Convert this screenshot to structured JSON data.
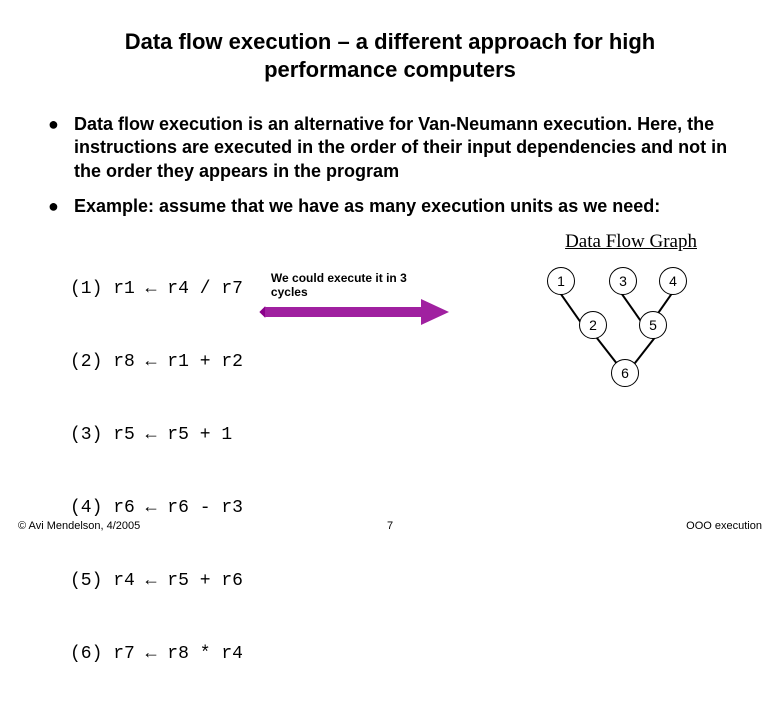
{
  "title": "Data flow execution – a different approach for high performance computers",
  "bullets": [
    "Data flow execution is an alternative for Van-Neumann execution. Here, the instructions are executed in the order of their input dependencies and not in the order they appears in the program",
    "Example: assume that we have as many execution units as we need:"
  ],
  "code": [
    {
      "n": "(1)",
      "d": "r1",
      "a": "←",
      "s1": "r4",
      "op": "/",
      "s2": "r7"
    },
    {
      "n": "(2)",
      "d": "r8",
      "a": "←",
      "s1": "r1",
      "op": "+",
      "s2": "r2"
    },
    {
      "n": "(3)",
      "d": "r5",
      "a": "←",
      "s1": "r5",
      "op": "+",
      "s2": "1"
    },
    {
      "n": "(4)",
      "d": "r6",
      "a": "←",
      "s1": "r6",
      "op": "-",
      "s2": "r3"
    },
    {
      "n": "(5)",
      "d": "r4",
      "a": "←",
      "s1": "r5",
      "op": "+",
      "s2": "r6"
    },
    {
      "n": "(6)",
      "d": "r7",
      "a": "←",
      "s1": "r8",
      "op": "*",
      "s2": "r4"
    }
  ],
  "note": "We could execute it in 3 cycles",
  "graph_title": "Data Flow Graph",
  "graph_nodes": [
    "1",
    "2",
    "3",
    "4",
    "5",
    "6"
  ],
  "footer": {
    "copyright": "© Avi Mendelson, 4/2005",
    "page": "7",
    "tag": "OOO execution"
  }
}
